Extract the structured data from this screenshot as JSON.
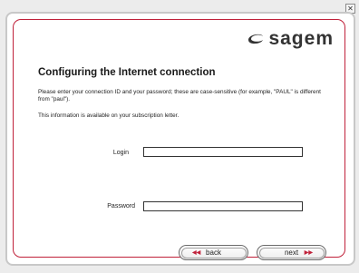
{
  "window": {
    "close_glyph": "✕"
  },
  "brand": {
    "logo_text": "sagem",
    "logo_icon": "sagem-swirl-icon"
  },
  "page": {
    "title": "Configuring the Internet connection",
    "paragraph1": "Please enter your connection ID and your password; these are case-sensitive (for example, \"PAUL\" is different from \"paul\").",
    "paragraph2": "This information is available on your subscription letter."
  },
  "form": {
    "login_label": "Login",
    "login_value": "",
    "password_label": "Password",
    "password_value": ""
  },
  "buttons": {
    "back_label": "back",
    "back_icon": "double-left-arrow-icon",
    "next_label": "next",
    "next_icon": "double-right-arrow-icon"
  },
  "colors": {
    "accent": "#c0213a",
    "text": "#222222"
  }
}
